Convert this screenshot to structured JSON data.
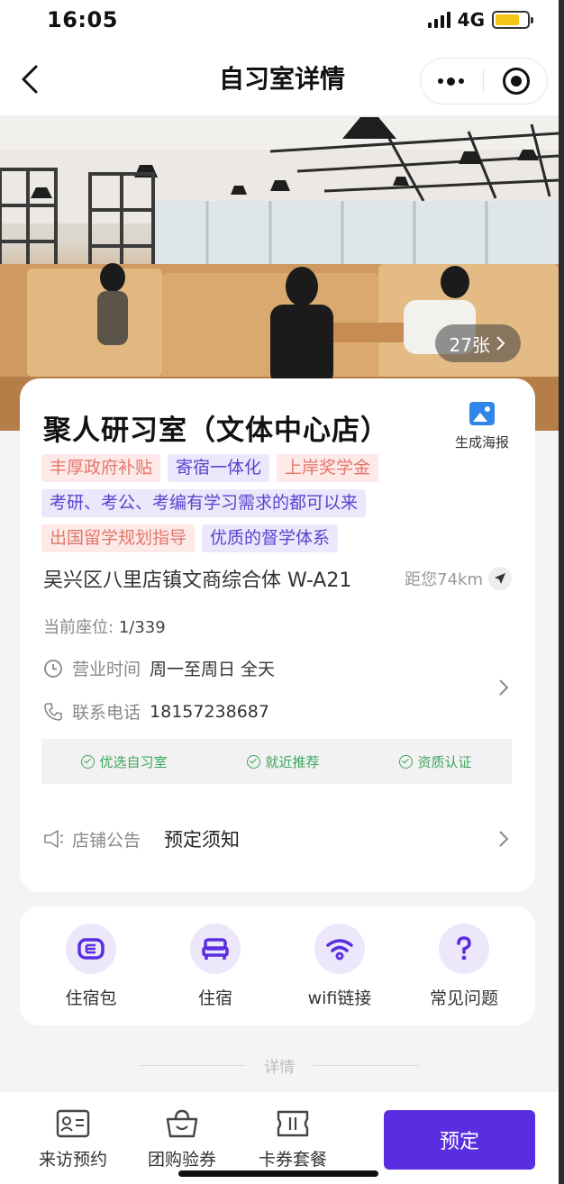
{
  "status_bar": {
    "time": "16:05",
    "network": "4G"
  },
  "nav": {
    "title": "自习室详情"
  },
  "hero": {
    "photo_count": "27张"
  },
  "shop": {
    "name": "聚人研习室（文体中心店）",
    "poster_label": "生成海报",
    "tags": [
      {
        "text": "丰厚政府补贴",
        "tone": "red"
      },
      {
        "text": "寄宿一体化",
        "tone": "purple"
      },
      {
        "text": "上岸奖学金",
        "tone": "red"
      },
      {
        "text": "考研、考公、考编有学习需求的都可以来",
        "tone": "purple"
      },
      {
        "text": "出国留学规划指导",
        "tone": "red"
      },
      {
        "text": "优质的督学体系",
        "tone": "purple"
      }
    ],
    "address": "吴兴区八里店镇文商综合体 W-A21",
    "distance": "距您74km",
    "seats_label": "当前座位:",
    "seats_value": "1/339",
    "hours_label": "营业时间",
    "hours_value": "周一至周日 全天",
    "phone_label": "联系电话",
    "phone_value": "18157238687",
    "badges": [
      "优选自习室",
      "就近推荐",
      "资质认证"
    ],
    "notice_label": "店铺公告",
    "notice_text": "预定须知"
  },
  "services": [
    {
      "label": "住宿包",
      "icon": "lodging-package-icon"
    },
    {
      "label": "住宿",
      "icon": "bed-icon"
    },
    {
      "label": "wifi链接",
      "icon": "wifi-icon"
    },
    {
      "label": "常见问题",
      "icon": "question-icon"
    }
  ],
  "section_divider": "详情",
  "bottom_bar": {
    "visit_label": "来访预约",
    "group_label": "团购验券",
    "card_label": "卡券套餐",
    "book_label": "预定"
  },
  "colors": {
    "accent": "#5a2ee0",
    "tag_purple": "#5844cf",
    "tag_red": "#e2786b",
    "badge_green": "#3da65b"
  }
}
